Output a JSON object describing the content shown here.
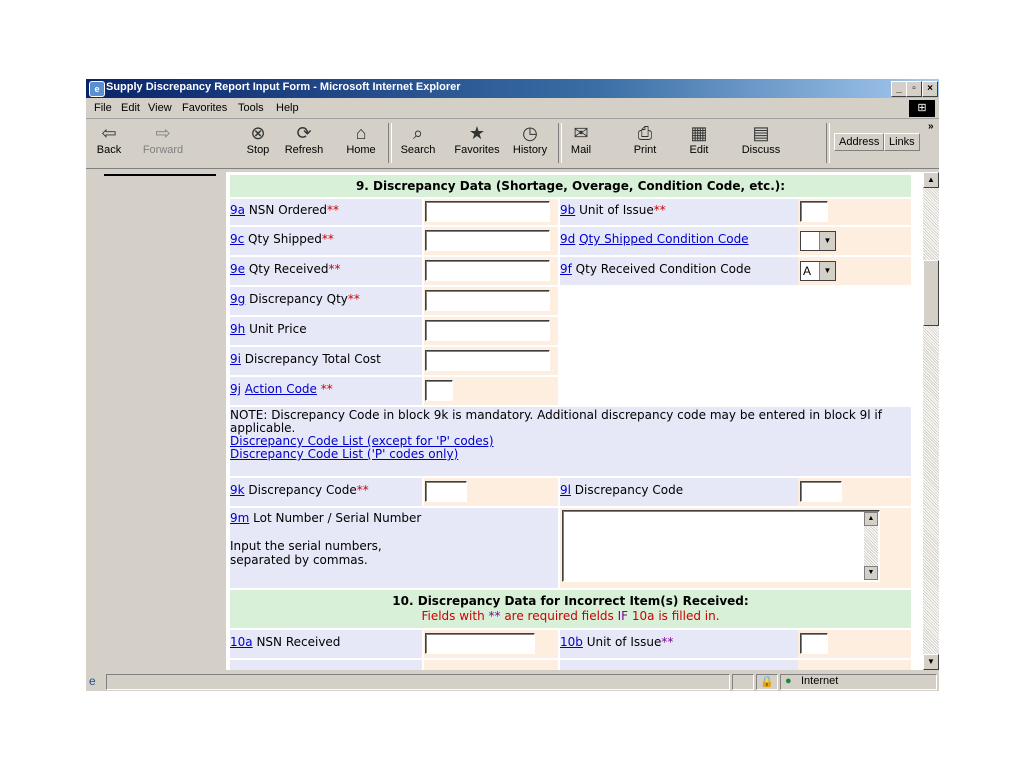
{
  "window": {
    "title": "Supply Discrepancy Report Input Form - Microsoft Internet Explorer"
  },
  "menu": [
    "File",
    "Edit",
    "View",
    "Favorites",
    "Tools",
    "Help"
  ],
  "toolbar": {
    "back": "Back",
    "forward": "Forward",
    "stop": "Stop",
    "refresh": "Refresh",
    "home": "Home",
    "search": "Search",
    "favorites": "Favorites",
    "history": "History",
    "mail": "Mail",
    "print": "Print",
    "edit": "Edit",
    "discuss": "Discuss",
    "address": "Address",
    "links": "Links"
  },
  "section9": {
    "header": "9. Discrepancy Data (Shortage, Overage, Condition Code, etc.):",
    "r9a": {
      "code": "9a",
      "label": " NSN Ordered",
      "req": "**"
    },
    "r9b": {
      "code": "9b",
      "label": " Unit of Issue",
      "req": "**"
    },
    "r9c": {
      "code": "9c",
      "label": " Qty Shipped",
      "req": "**"
    },
    "r9d": {
      "code": "9d",
      "link": "Qty Shipped Condition Code",
      "value": ""
    },
    "r9e": {
      "code": "9e",
      "label": " Qty Received",
      "req": "**"
    },
    "r9f": {
      "code": "9f",
      "label": " Qty Received Condition Code",
      "value": "A"
    },
    "r9g": {
      "code": "9g",
      "label": " Discrepancy Qty",
      "req": "**"
    },
    "r9h": {
      "code": "9h",
      "label": " Unit Price"
    },
    "r9i": {
      "code": "9i",
      "label": " Discrepancy Total Cost"
    },
    "r9j": {
      "code": "9j",
      "link": "Action Code",
      "req": " **"
    },
    "note": "NOTE: Discrepancy Code in block 9k is mandatory. Additional discrepancy code may be entered in block 9l if applicable.",
    "link_list1": "Discrepancy Code List (except for 'P' codes)",
    "link_list2": "Discrepancy Code List ('P' codes only)",
    "r9k": {
      "code": "9k",
      "label": " Discrepancy Code",
      "req": "**"
    },
    "r9l": {
      "code": "9l",
      "label": " Discrepancy Code"
    },
    "r9m": {
      "code": "9m",
      "label": " Lot Number / Serial Number",
      "help": "Input the serial numbers, separated by commas."
    }
  },
  "section10": {
    "header": "10. Discrepancy Data for Incorrect Item(s) Received:",
    "sub_a": "Fields with ",
    "sub_req": "**",
    "sub_b": " are required fields ",
    "sub_if": "IF",
    "sub_c": " 10a is filled in.",
    "r10a": {
      "code": "10a",
      "label": " NSN Received"
    },
    "r10b": {
      "code": "10b",
      "label": " Unit of Issue",
      "req": "**"
    }
  },
  "status": {
    "zone": "Internet"
  }
}
